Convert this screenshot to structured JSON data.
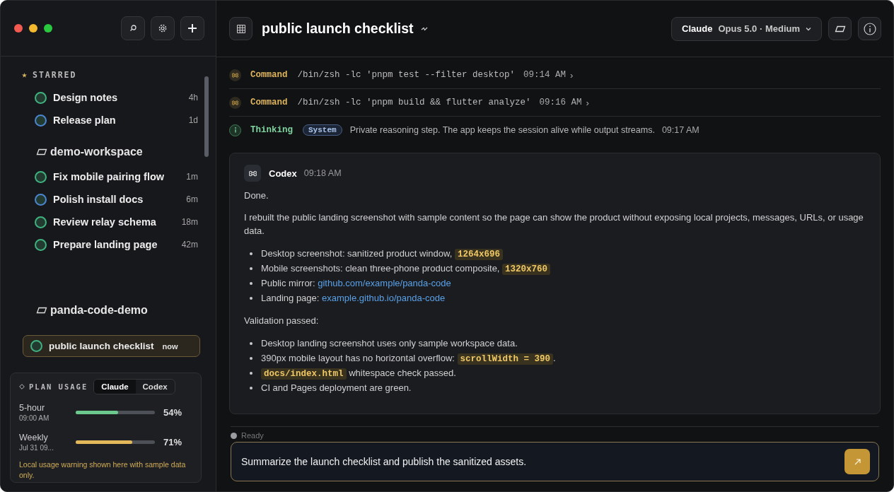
{
  "sidebar": {
    "starred": {
      "title": "STARRED",
      "items": [
        {
          "title": "Design notes",
          "age": "4h",
          "color": "#3fb27f",
          "selected": false
        },
        {
          "title": "Release plan",
          "age": "1d",
          "color": "#4a86d0",
          "selected": false
        }
      ]
    },
    "groups": [
      {
        "name": "demo-workspace",
        "items": [
          {
            "title": "Fix mobile pairing flow",
            "age": "1m",
            "color": "#3fb27f",
            "selected": false
          },
          {
            "title": "Polish install docs",
            "age": "6m",
            "color": "#4a86d0",
            "selected": false
          },
          {
            "title": "Review relay schema",
            "age": "18m",
            "color": "#3fb27f",
            "selected": false
          },
          {
            "title": "Prepare landing page",
            "age": "42m",
            "color": "#3fb27f",
            "selected": false
          }
        ]
      },
      {
        "name": "panda-code-demo",
        "items": [
          {
            "title": "public launch checklist",
            "age": "now",
            "color": "#3fb27f",
            "selected": true
          }
        ]
      }
    ]
  },
  "usage": {
    "title": "PLAN USAGE",
    "tabs": [
      {
        "label": "Claude",
        "selected": true
      },
      {
        "label": "Codex",
        "selected": false
      }
    ],
    "meters": [
      {
        "label": "5-hour",
        "reset": "09:00 AM",
        "level": 0.54,
        "reading": "54%",
        "color": "#6cc98d"
      },
      {
        "label": "Weekly",
        "reset": "Jul 31 09...",
        "level": 0.71,
        "reading": "71%",
        "color": "#e2b85a"
      }
    ],
    "note": "Local usage warning shown here with sample data only."
  },
  "header": {
    "title": "public launch checklist",
    "provider": "Claude",
    "model": "Opus 5.0 · Medium"
  },
  "events": [
    {
      "kind": "command",
      "label": "Command",
      "text": "/bin/zsh -lc 'pnpm test --filter desktop'",
      "time": "09:14 AM",
      "more": "›"
    },
    {
      "kind": "command",
      "label": "Command",
      "text": "/bin/zsh -lc 'pnpm build && flutter analyze'",
      "time": "09:16 AM",
      "more": "›"
    },
    {
      "kind": "thinking",
      "label": "Thinking",
      "badge": "System",
      "text": "Private reasoning step. The app keeps the session alive while output streams.",
      "time": "09:17 AM"
    }
  ],
  "message": {
    "author": "Codex",
    "time": "09:18 AM",
    "blocks": [
      {
        "kind": "para",
        "text": "Done."
      },
      {
        "kind": "para",
        "text": "I rebuilt the public landing screenshot with sample content so the page can show the product without exposing local projects, messages, URLs, or usage data."
      },
      {
        "kind": "list",
        "items": [
          [
            {
              "kind": "text",
              "text": "Desktop screenshot: sanitized product window, "
            },
            {
              "kind": "code",
              "text": "1264x696"
            }
          ],
          [
            {
              "kind": "text",
              "text": "Mobile screenshots: clean three-phone product composite, "
            },
            {
              "kind": "code",
              "text": "1320x760"
            }
          ],
          [
            {
              "kind": "text",
              "text": "Public mirror: "
            },
            {
              "kind": "link",
              "text": "github.com/example/panda-code"
            }
          ],
          [
            {
              "kind": "text",
              "text": "Landing page: "
            },
            {
              "kind": "link",
              "text": "example.github.io/panda-code"
            }
          ]
        ]
      },
      {
        "kind": "para",
        "text": "Validation passed:"
      },
      {
        "kind": "list",
        "items": [
          [
            {
              "kind": "text",
              "text": "Desktop landing screenshot uses only sample workspace data."
            }
          ],
          [
            {
              "kind": "text",
              "text": "390px mobile layout has no horizontal overflow: "
            },
            {
              "kind": "code",
              "text": "scrollWidth = 390"
            },
            {
              "kind": "text",
              "text": "."
            }
          ],
          [
            {
              "kind": "code",
              "text": "docs/index.html"
            },
            {
              "kind": "text",
              "text": " whitespace check passed."
            }
          ],
          [
            {
              "kind": "text",
              "text": "CI and Pages deployment are green."
            }
          ]
        ]
      }
    ]
  },
  "composer": {
    "status": "Ready",
    "value": "Summarize the launch checklist and publish the sanitized assets."
  }
}
